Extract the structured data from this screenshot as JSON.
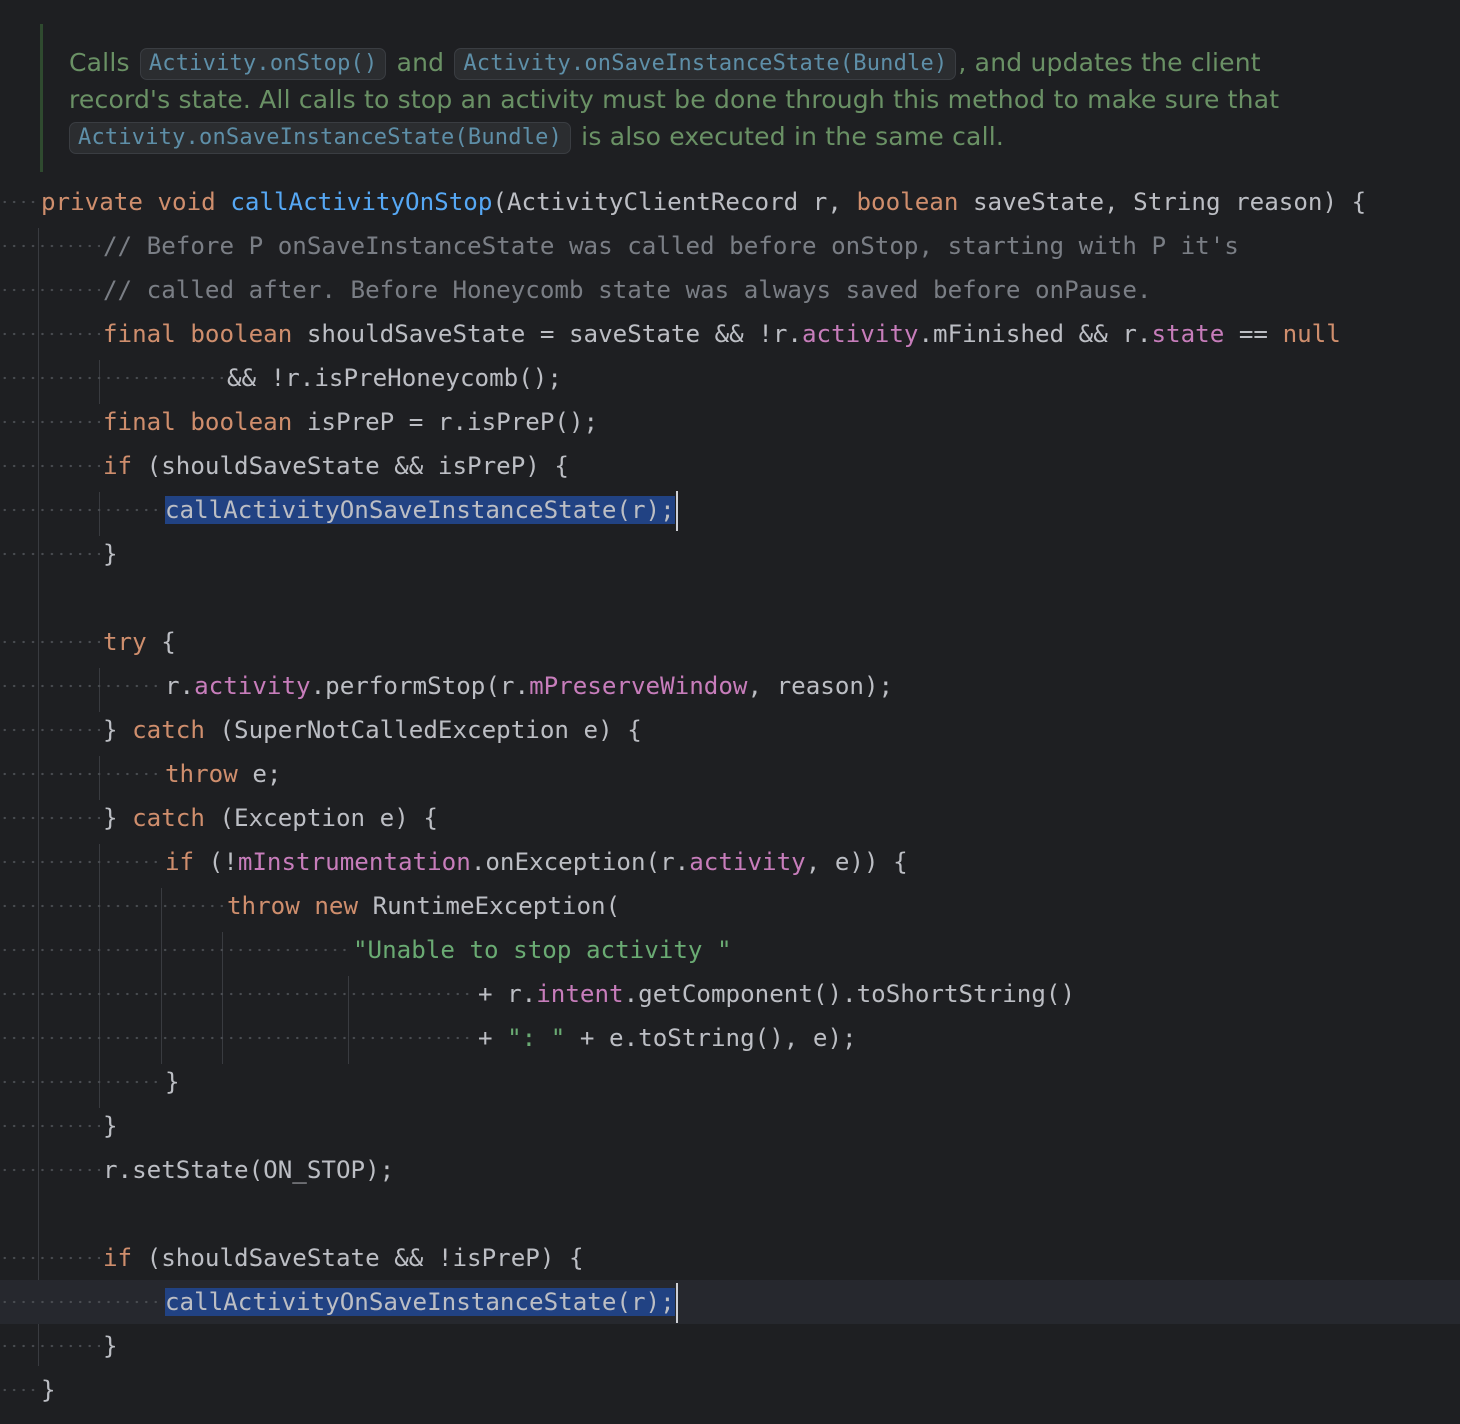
{
  "javadoc": {
    "line1_prefix": "Calls ",
    "line1_code1": "Activity.onStop()",
    "line1_mid": " and ",
    "line1_code2": "Activity.onSaveInstanceState(Bundle)",
    "line1_suffix": ", and updates the client",
    "line2": "record's state. All calls to stop an activity must be done through this method to make sure that",
    "line3_code": "Activity.onSaveInstanceState(Bundle)",
    "line3_suffix": " is also executed in the same call."
  },
  "code": {
    "signature": {
      "kw_private": "private",
      "kw_void": "void",
      "method": "callActivityOnStop",
      "params_a": "(ActivityClientRecord r, ",
      "kw_boolean": "boolean",
      "params_b": " saveState, String reason) {"
    },
    "comment1": "// Before P onSaveInstanceState was called before onStop, starting with P it's",
    "comment2": "// called after. Before Honeycomb state was always saved before onPause.",
    "line_should": {
      "kw_final": "final",
      "kw_boolean": "boolean",
      "a": " shouldSaveState = saveState && !r.",
      "f_activity": "activity",
      "b": ".mFinished && r.",
      "f_state": "state",
      "c": " == ",
      "kw_null": "null"
    },
    "line_should_cont": "&& !r.isPreHoneycomb();",
    "line_isprep": {
      "kw_final": "final",
      "kw_boolean": "boolean",
      "a": " isPreP = r.isPreP();"
    },
    "if1": {
      "kw_if": "if",
      "a": " (shouldSaveState && isPreP) {"
    },
    "call1": "callActivityOnSaveInstanceState(r);",
    "close_brace": "}",
    "try": {
      "kw_try": "try",
      "a": " {"
    },
    "perform": {
      "a": "r.",
      "f_activity": "activity",
      "b": ".performStop(r.",
      "f_window": "mPreserveWindow",
      "c": ", reason);"
    },
    "catch1": {
      "a": "} ",
      "kw_catch": "catch",
      "b": " (SuperNotCalledException e) {"
    },
    "throw_e": {
      "kw_throw": "throw",
      "a": " e;"
    },
    "catch2": {
      "a": "} ",
      "kw_catch": "catch",
      "b": " (Exception e) {"
    },
    "if_instr": {
      "kw_if": "if",
      "a": " (!",
      "f_instr": "mInstrumentation",
      "b": ".onException(r.",
      "f_activity": "activity",
      "c": ", e)) {"
    },
    "throw_new": {
      "kw_throw": "throw",
      "kw_new": "new",
      "a": " RuntimeException("
    },
    "str_unable": "\"Unable to stop activity \"",
    "plus_intent": {
      "a": "+ r.",
      "f_intent": "intent",
      "b": ".getComponent().toShortString()"
    },
    "plus_str": {
      "a": "+ ",
      "s": "\": \"",
      "b": " + e.toString(), e);"
    },
    "setstate": "r.setState(ON_STOP);",
    "if2": {
      "kw_if": "if",
      "a": " (shouldSaveState && !isPreP) {"
    },
    "call2": "callActivityOnSaveInstanceState(r);"
  }
}
